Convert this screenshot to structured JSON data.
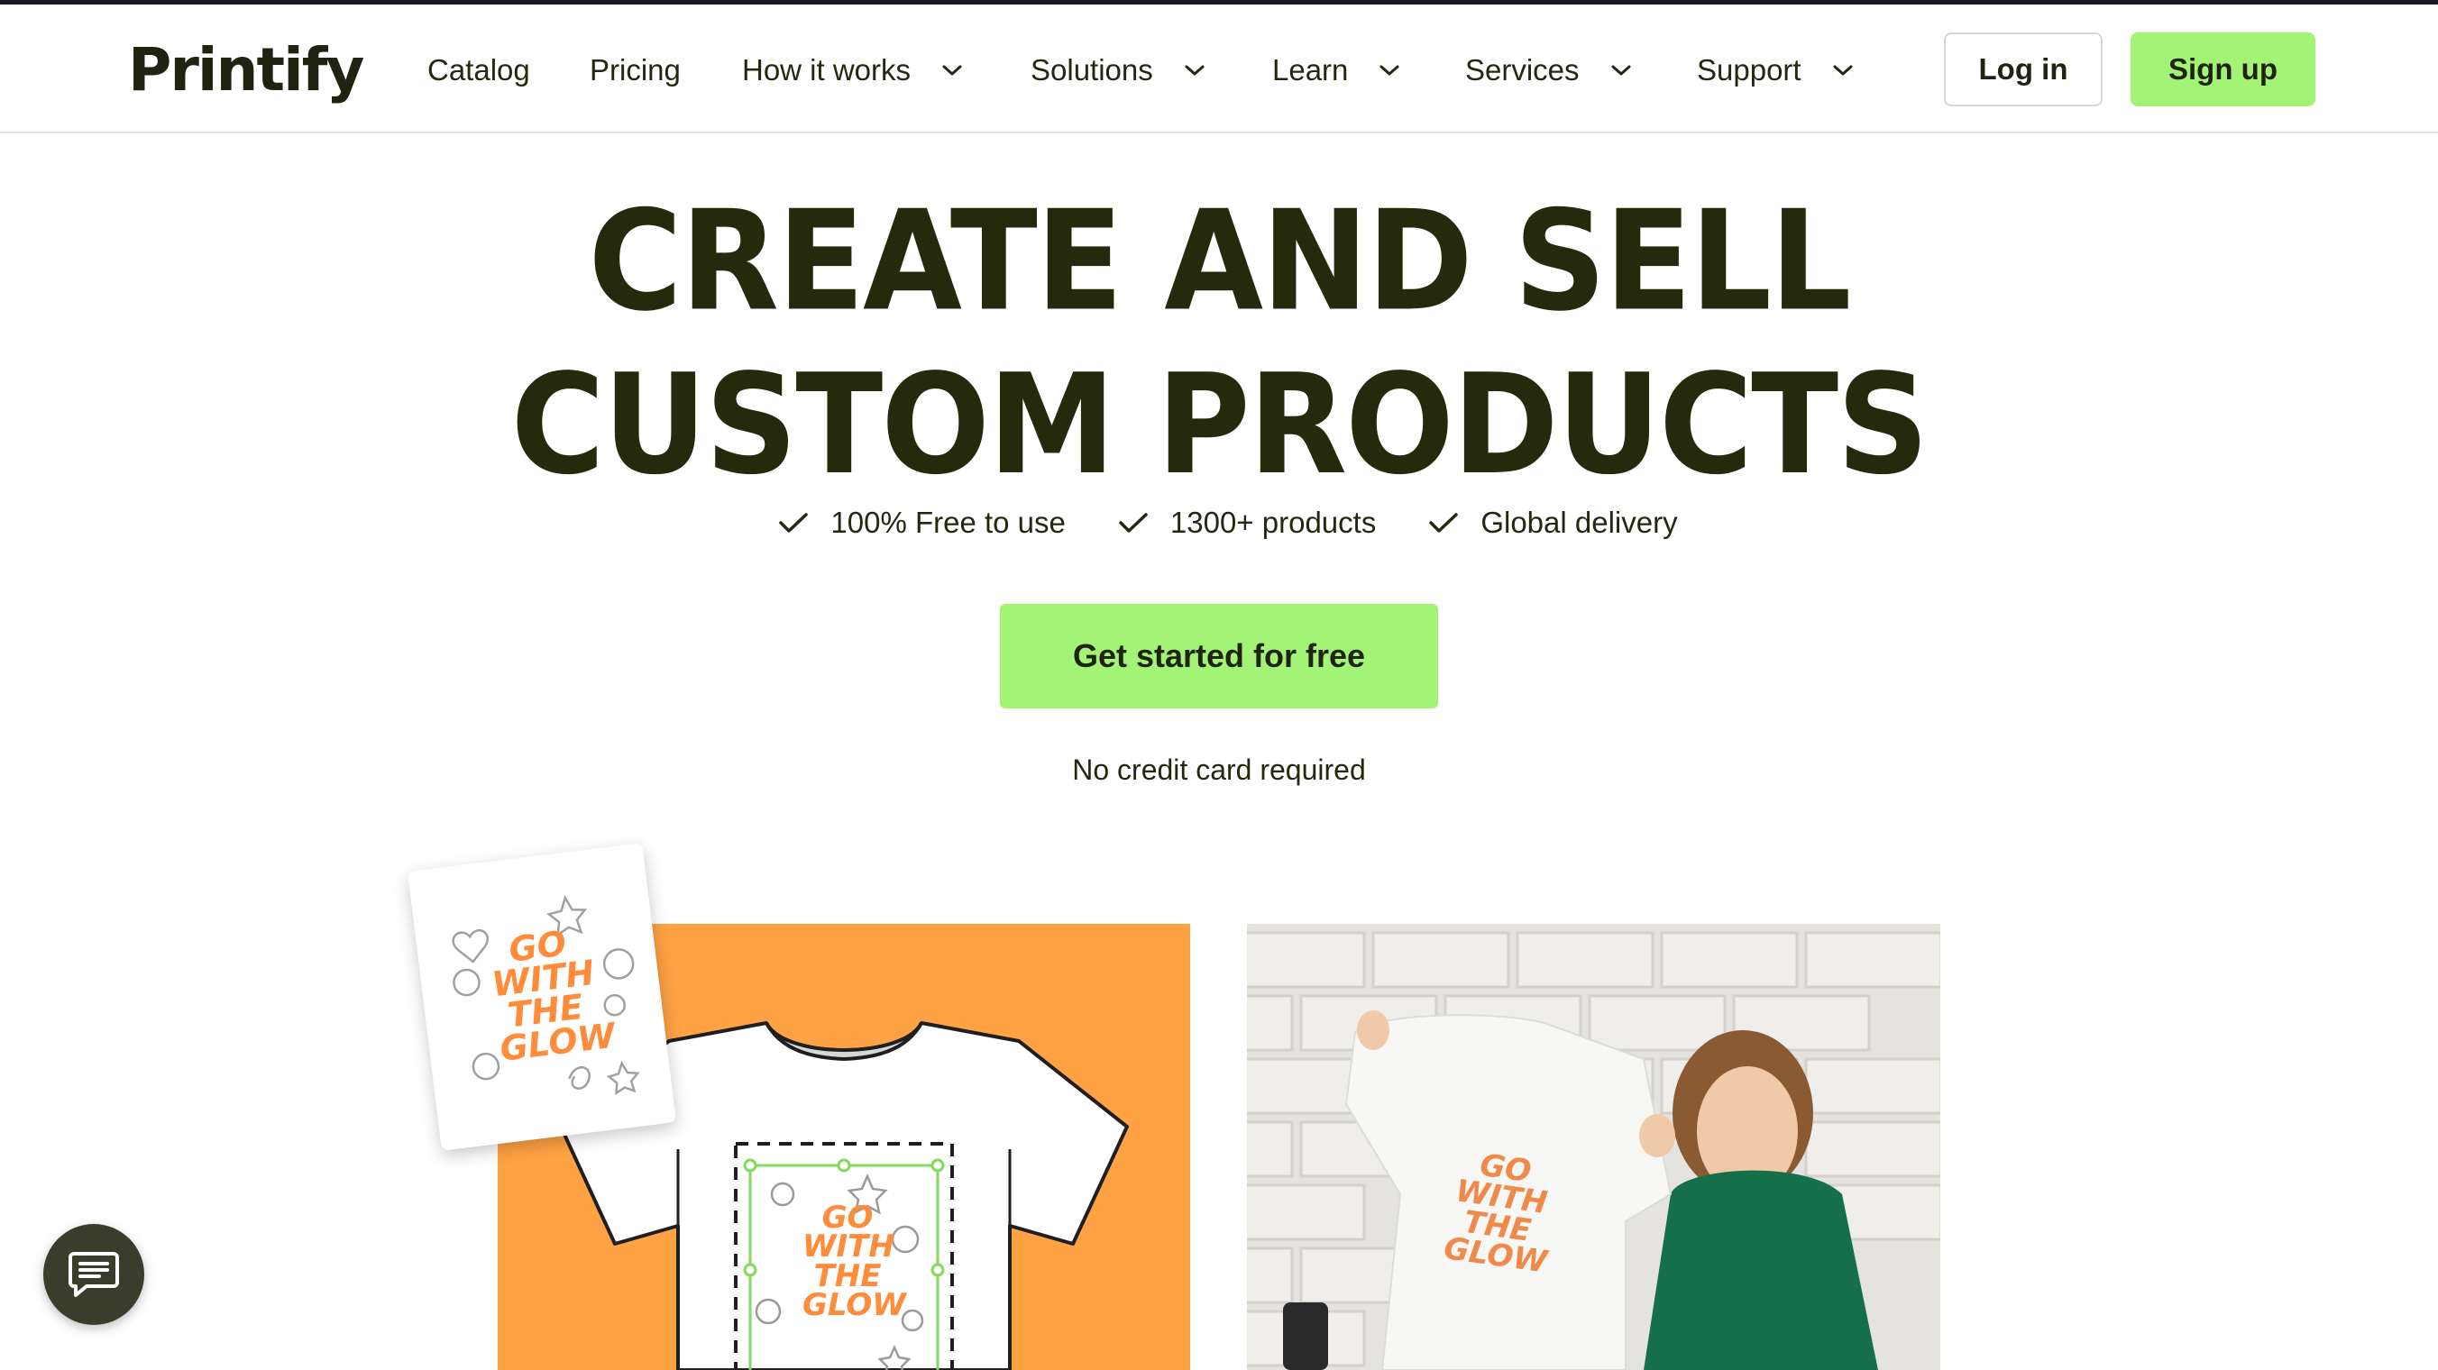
{
  "brand": {
    "logo_text": "Printify",
    "accent": "#a3f376",
    "text_color": "#24280f"
  },
  "nav": {
    "items": [
      {
        "label": "Catalog",
        "dropdown": false
      },
      {
        "label": "Pricing",
        "dropdown": false
      },
      {
        "label": "How it works",
        "dropdown": true
      },
      {
        "label": "Solutions",
        "dropdown": true
      },
      {
        "label": "Learn",
        "dropdown": true
      },
      {
        "label": "Services",
        "dropdown": true
      },
      {
        "label": "Support",
        "dropdown": true
      }
    ],
    "login_label": "Log in",
    "signup_label": "Sign up"
  },
  "hero": {
    "title_line1": "CREATE AND SELL",
    "title_line2": "CUSTOM PRODUCTS",
    "features": [
      "100% Free to use",
      "1300+ products",
      "Global delivery"
    ],
    "cta_label": "Get started for free",
    "subnote": "No credit card required"
  },
  "illustration": {
    "design_text_lines": [
      "GO",
      "WITH",
      "THE",
      "GLOW"
    ],
    "panel_color": "#ffa244"
  },
  "chat": {
    "icon": "chat-icon"
  }
}
